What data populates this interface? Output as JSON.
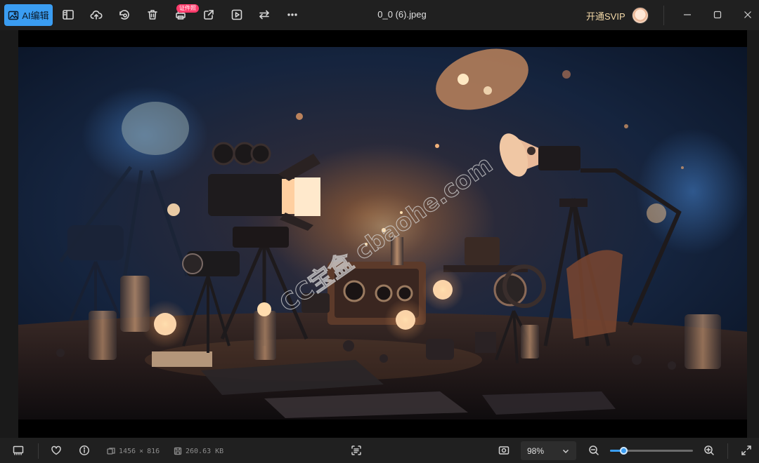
{
  "toolbar": {
    "ai_edit_label": "AI编辑",
    "badge_label": "证件照",
    "file_name": "0_0 (6).jpeg",
    "svip_label": "开通SVIP",
    "icons": [
      "sidebar-icon",
      "upload-cloud-icon",
      "rotate-icon",
      "delete-icon",
      "print-icon",
      "share-icon",
      "play-icon",
      "swap-icon",
      "more-icon"
    ]
  },
  "image": {
    "watermark": "CC宝盒 cbaohe.com",
    "description_colors": {
      "bg_dark": "#0f1a2e",
      "warm_light": "#f2b27a"
    }
  },
  "status": {
    "width": "1456",
    "times": "×",
    "height": "816",
    "file_size": "260.63 KB",
    "zoom_value": "98%",
    "zoom_fraction": 0.16
  },
  "colors": {
    "accent": "#3a9df2",
    "badge": "#ff3b6b",
    "svip": "#f3d9a8"
  }
}
